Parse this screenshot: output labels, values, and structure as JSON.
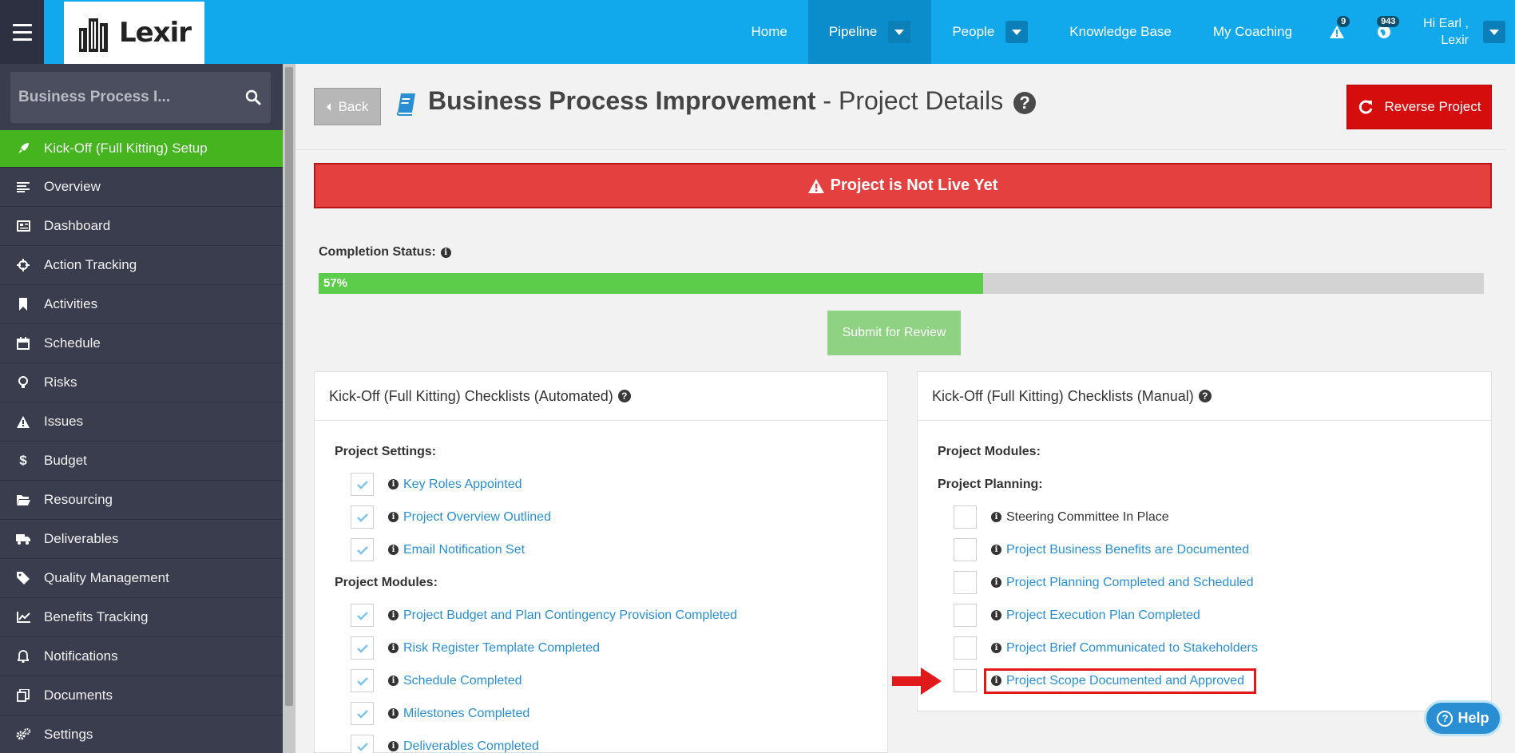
{
  "app": {
    "logo_text": "Lexir"
  },
  "nav": {
    "items": [
      {
        "label": "Home",
        "active": false,
        "dropdown": false
      },
      {
        "label": "Pipeline",
        "active": true,
        "dropdown": true
      },
      {
        "label": "People",
        "active": false,
        "dropdown": true
      },
      {
        "label": "Knowledge Base",
        "active": false,
        "dropdown": false
      },
      {
        "label": "My Coaching",
        "active": false,
        "dropdown": false
      }
    ],
    "alerts_badge": "9",
    "globe_badge": "943",
    "user_greeting_line1": "Hi Earl ,",
    "user_greeting_line2": "Lexir"
  },
  "sidebar": {
    "search_value": "Business Process I...",
    "items": [
      {
        "label": "Kick-Off (Full Kitting) Setup",
        "icon": "rocket-icon",
        "active": true
      },
      {
        "label": "Overview",
        "icon": "list-icon",
        "active": false
      },
      {
        "label": "Dashboard",
        "icon": "newspaper-icon",
        "active": false
      },
      {
        "label": "Action Tracking",
        "icon": "crosshair-icon",
        "active": false
      },
      {
        "label": "Activities",
        "icon": "bookmark-icon",
        "active": false
      },
      {
        "label": "Schedule",
        "icon": "calendar-icon",
        "active": false
      },
      {
        "label": "Risks",
        "icon": "lightbulb-icon",
        "active": false
      },
      {
        "label": "Issues",
        "icon": "warning-icon",
        "active": false
      },
      {
        "label": "Budget",
        "icon": "dollar-icon",
        "active": false
      },
      {
        "label": "Resourcing",
        "icon": "folder-icon",
        "active": false
      },
      {
        "label": "Deliverables",
        "icon": "truck-icon",
        "active": false
      },
      {
        "label": "Quality Management",
        "icon": "tag-icon",
        "active": false
      },
      {
        "label": "Benefits Tracking",
        "icon": "line-chart-icon",
        "active": false
      },
      {
        "label": "Notifications",
        "icon": "bell-icon",
        "active": false
      },
      {
        "label": "Documents",
        "icon": "copy-icon",
        "active": false
      },
      {
        "label": "Settings",
        "icon": "gears-icon",
        "active": false
      }
    ]
  },
  "header": {
    "back_label": "Back",
    "title_bold": "Business Process Improvement",
    "title_rest": " - Project Details",
    "reverse_label": "Reverse Project"
  },
  "alert": {
    "text": "Project is Not Live Yet"
  },
  "completion": {
    "label": "Completion Status:",
    "percent": 57,
    "percent_text": "57%",
    "submit_label": "Submit for Review"
  },
  "automated_panel": {
    "title": "Kick-Off (Full Kitting) Checklists (Automated)",
    "sections": [
      {
        "label": "Project Settings:",
        "items": [
          {
            "label": "Key Roles Appointed",
            "checked": true
          },
          {
            "label": "Project Overview Outlined",
            "checked": true
          },
          {
            "label": "Email Notification Set",
            "checked": true
          }
        ]
      },
      {
        "label": "Project Modules:",
        "items": [
          {
            "label": "Project Budget and Plan Contingency Provision Completed",
            "checked": true
          },
          {
            "label": "Risk Register Template Completed",
            "checked": true
          },
          {
            "label": "Schedule Completed",
            "checked": true
          },
          {
            "label": "Milestones Completed",
            "checked": true
          },
          {
            "label": "Deliverables Completed",
            "checked": true
          }
        ]
      }
    ]
  },
  "manual_panel": {
    "title": "Kick-Off (Full Kitting) Checklists (Manual)",
    "modules_label": "Project Modules:",
    "planning_label": "Project Planning:",
    "items": [
      {
        "label": "Steering Committee In Place",
        "checked": false,
        "link": false
      },
      {
        "label": "Project Business Benefits are Documented",
        "checked": false,
        "link": true
      },
      {
        "label": "Project Planning Completed and Scheduled",
        "checked": false,
        "link": true
      },
      {
        "label": "Project Execution Plan Completed",
        "checked": false,
        "link": true
      },
      {
        "label": "Project Brief Communicated to Stakeholders",
        "checked": false,
        "link": true
      },
      {
        "label": "Project Scope Documented and Approved",
        "checked": false,
        "link": true,
        "highlighted": true
      }
    ]
  },
  "help_button": {
    "label": "Help"
  }
}
